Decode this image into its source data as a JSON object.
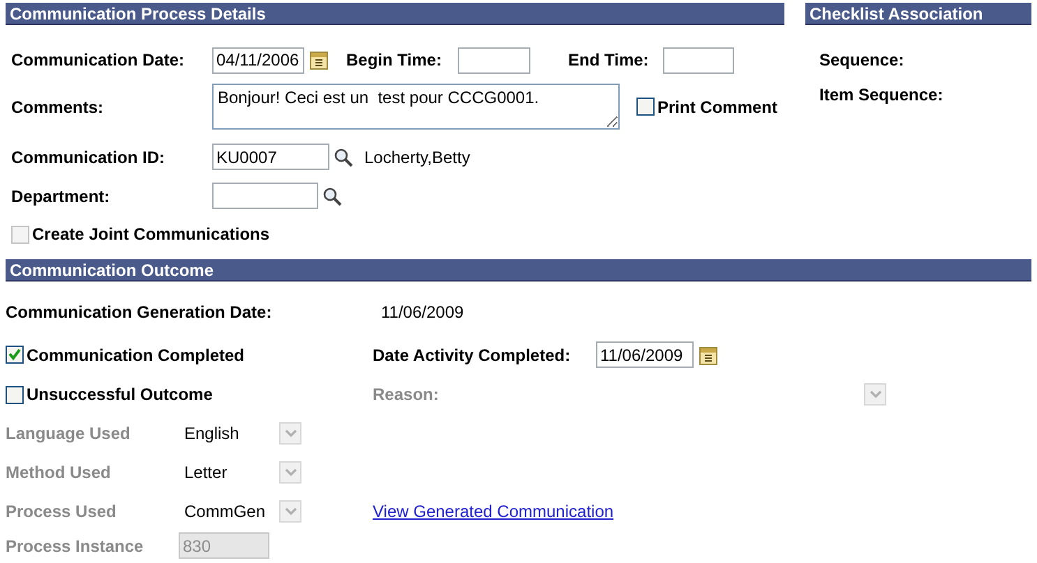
{
  "process_details": {
    "title": "Communication Process Details",
    "communication_date": {
      "label": "Communication Date:",
      "value": "04/11/2006"
    },
    "begin_time": {
      "label": "Begin Time:"
    },
    "end_time": {
      "label": "End Time:"
    },
    "comments": {
      "label": "Comments:",
      "value": "Bonjour! Ceci est un  test pour CCCG0001."
    },
    "print_comment": {
      "label": "Print Comment",
      "checked": false,
      "disabled": false
    },
    "communication_id": {
      "label": "Communication ID:",
      "value": "KU0007",
      "name": "Locherty,Betty"
    },
    "department": {
      "label": "Department:"
    },
    "create_joint": {
      "label": "Create Joint Communications",
      "checked": false,
      "disabled": true
    }
  },
  "checklist": {
    "title": "Checklist Association",
    "fields": [
      {
        "label": "Sequence:"
      },
      {
        "label": "Item Sequence:"
      }
    ]
  },
  "outcome": {
    "title": "Communication Outcome",
    "generation_date": {
      "label": "Communication Generation Date:",
      "value": "11/06/2009"
    },
    "completed": {
      "label": "Communication Completed",
      "checked": true,
      "disabled": false
    },
    "date_activity_completed": {
      "label": "Date Activity Completed:",
      "value": "11/06/2009"
    },
    "unsuccessful": {
      "label": "Unsuccessful Outcome",
      "checked": false,
      "disabled": false
    },
    "reason": {
      "label": "Reason:",
      "disabled": true
    },
    "selects": [
      {
        "label": "Language Used",
        "value": "English",
        "disabled": true
      },
      {
        "label": "Method Used",
        "value": "Letter",
        "disabled": true
      },
      {
        "label": "Process Used",
        "value": "CommGen",
        "disabled": true
      }
    ],
    "link": "View Generated Communication",
    "process_instance": {
      "label": "Process Instance",
      "value": "830",
      "disabled": true
    }
  }
}
